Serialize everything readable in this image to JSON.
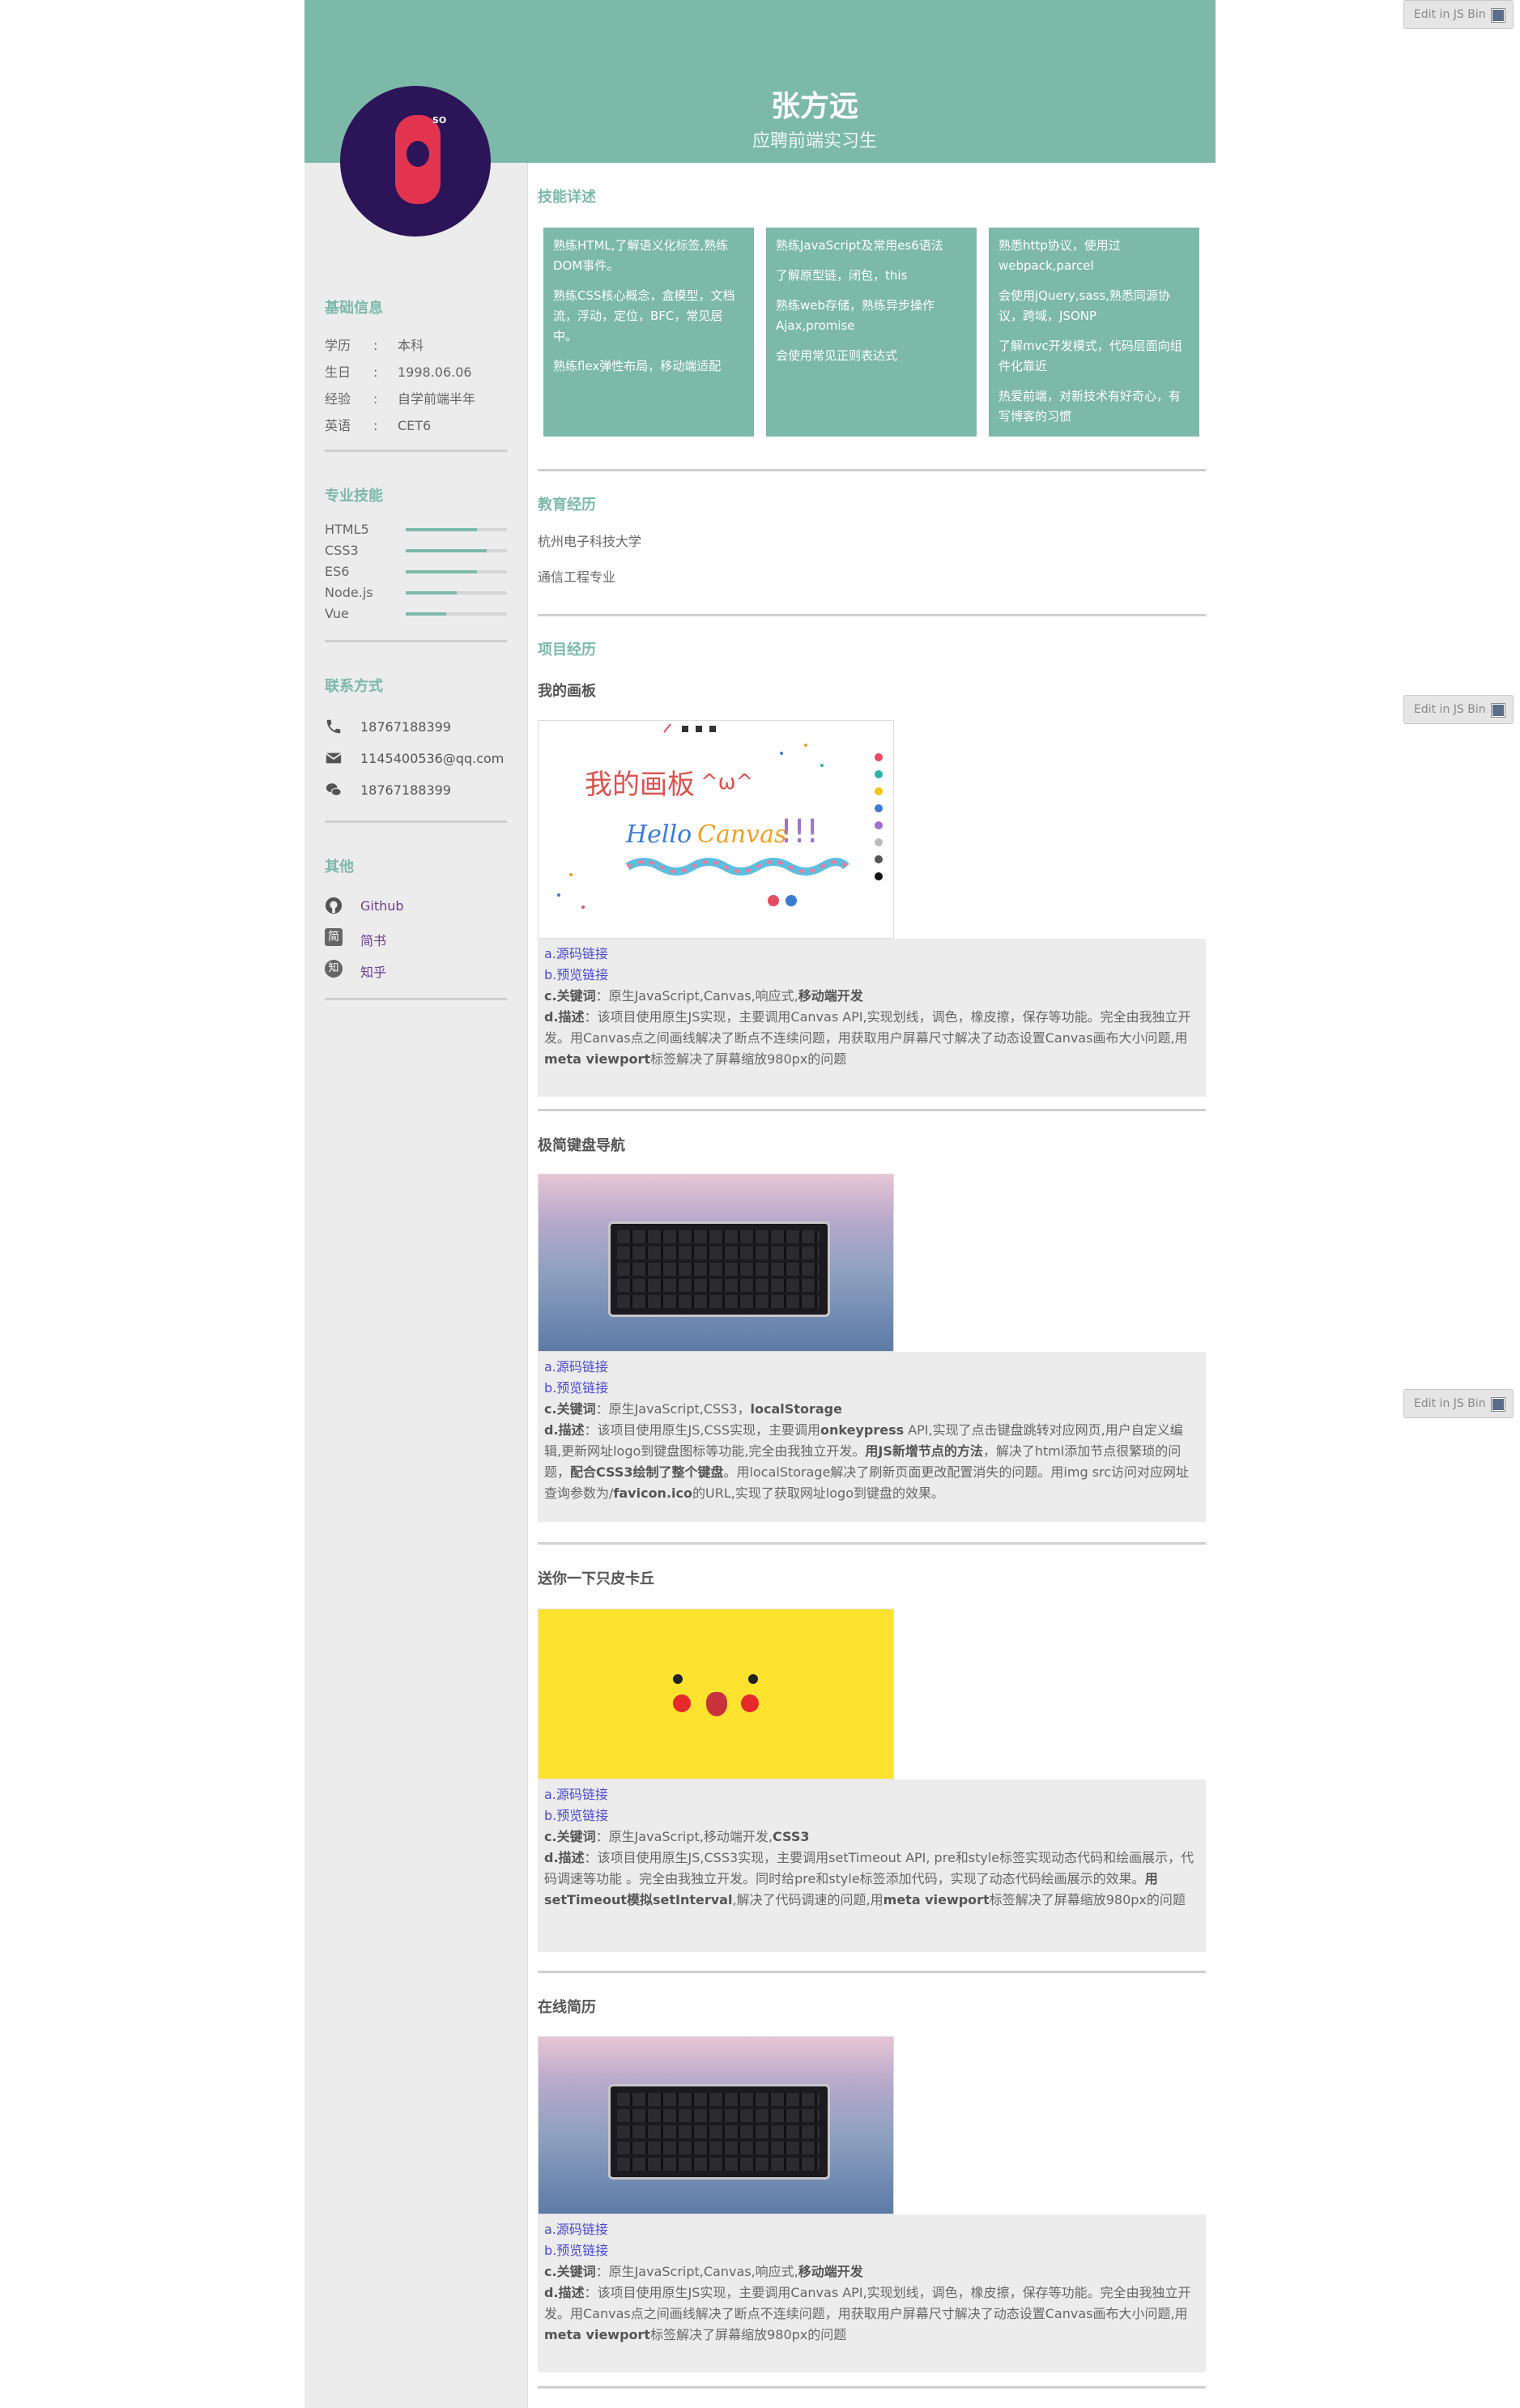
{
  "profile": {
    "name": "张方远",
    "role": "应聘前端实习生",
    "avatar_badge": "SO"
  },
  "sidebar": {
    "basic_title": "基础信息",
    "basic": [
      {
        "key": "学历",
        "sep": ":",
        "value": "本科"
      },
      {
        "key": "生日",
        "sep": ":",
        "value": "1998.06.06"
      },
      {
        "key": "经验",
        "sep": ":",
        "value": "自学前端半年"
      },
      {
        "key": "英语",
        "sep": ":",
        "value": "CET6"
      }
    ],
    "skills_title": "专业技能",
    "skills": [
      {
        "name": "HTML5",
        "level": 0.7
      },
      {
        "name": "CSS3",
        "level": 0.8
      },
      {
        "name": "ES6",
        "level": 0.7
      },
      {
        "name": "Node.js",
        "level": 0.5
      },
      {
        "name": "Vue",
        "level": 0.4
      }
    ],
    "contact_title": "联系方式",
    "contacts": [
      {
        "icon": "phone-icon",
        "text": "18767188399"
      },
      {
        "icon": "mail-icon",
        "text": "1145400536@qq.com"
      },
      {
        "icon": "wechat-icon",
        "text": "18767188399"
      }
    ],
    "other_title": "其他",
    "links": [
      {
        "icon": "github-icon",
        "glyph": "",
        "text": "Github"
      },
      {
        "icon": "jianshu-icon",
        "glyph": "简",
        "text": "简书"
      },
      {
        "icon": "zhihu-icon",
        "glyph": "知",
        "text": "知乎"
      }
    ]
  },
  "main": {
    "skills_title": "技能详述",
    "skill_boxes": [
      [
        "熟练HTML,了解语义化标签,熟练DOM事件。",
        "熟练CSS核心概念，盒模型，文档流，浮动，定位，BFC，常见居中。",
        "熟练flex弹性布局，移动端适配"
      ],
      [
        "熟练JavaScript及常用es6语法",
        "了解原型链，闭包，this",
        "熟练web存储，熟练异步操作Ajax,promise",
        "会使用常见正则表达式"
      ],
      [
        "熟悉http协议，使用过webpack,parcel",
        "会使用jQuery,sass,熟悉同源协议，跨域，JSONP",
        "了解mvc开发模式，代码层面向组件化靠近",
        "热爱前端，对新技术有好奇心，有写博客的习惯"
      ]
    ],
    "edu_title": "教育经历",
    "edu": [
      "杭州电子科技大学",
      "通信工程专业"
    ],
    "proj_title": "项目经历",
    "projects": [
      {
        "title": "我的画板",
        "source_link": "a.源码链接",
        "preview_link": "b.预览链接",
        "kw_label": "c.关键词",
        "kw_text": "：原生JavaScript,Canvas,响应式,",
        "kw_bold": "移动端开发",
        "desc_label": "d.描述",
        "desc_parts": [
          [
            "：该项目使用原生JS实现，主要调用Canvas API,实现划线，调色，橡皮擦，保存等功能。完全由我独立开发。用Canvas点之间画线解决了断点不连续问题，用获取用户屏幕尺寸解决了动态设置Canvas画布大小问题,用",
            false
          ],
          [
            "meta viewport",
            true
          ],
          [
            "标签解决了屏幕缩放980px的问题",
            false
          ]
        ]
      },
      {
        "title": "极简键盘导航",
        "source_link": "a.源码链接",
        "preview_link": "b.预览链接",
        "kw_label": "c.关键词",
        "kw_text": "：原生JavaScript,CSS3，",
        "kw_bold": "localStorage",
        "desc_label": "d.描述",
        "desc_parts": [
          [
            "：该项目使用原生JS,CSS实现，主要调用",
            false
          ],
          [
            "onkeypress",
            true
          ],
          [
            " API,实现了点击键盘跳转对应网页,用户自定义编辑,更新网址logo到键盘图标等功能,完全由我独立开发。",
            false
          ],
          [
            "用JS新增节点的方法",
            true
          ],
          [
            "，解决了html添加节点很繁琐的问题，",
            false
          ],
          [
            "配合CSS3绘制了整个键盘",
            true
          ],
          [
            "。用localStorage解决了刷新页面更改配置消失的问题。用img src访问对应网址查询参数为/",
            false
          ],
          [
            "favicon.ico",
            true
          ],
          [
            "的URL,实现了获取网址logo到键盘的效果。",
            false
          ]
        ]
      },
      {
        "title": "送你一下只皮卡丘",
        "source_link": "a.源码链接",
        "preview_link": "b.预览链接",
        "kw_label": "c.关键词",
        "kw_text": "：原生JavaScript,移动端开发,",
        "kw_bold": "CSS3",
        "desc_label": "d.描述",
        "desc_parts": [
          [
            "：该项目使用原生JS,CSS3实现，主要调用setTimeout API, pre和style标签实现动态代码和绘画展示，代码调速等功能 。完全由我独立开发。同时给pre和style标签添加代码，实现了动态代码绘画展示的效果。",
            false
          ],
          [
            "用setTimeout模拟setInterval",
            true
          ],
          [
            ",解决了代码调速的问题,用",
            false
          ],
          [
            "meta viewport",
            true
          ],
          [
            "标签解决了屏幕缩放980px的问题",
            false
          ]
        ]
      },
      {
        "title": "在线简历",
        "source_link": "a.源码链接",
        "preview_link": "b.预览链接",
        "kw_label": "c.关键词",
        "kw_text": "：原生JavaScript,Canvas,响应式,",
        "kw_bold": "移动端开发",
        "desc_label": "d.描述",
        "desc_parts": [
          [
            "：该项目使用原生JS实现，主要调用Canvas API,实现划线，调色，橡皮擦，保存等功能。完全由我独立开发。用Canvas点之间画线解决了断点不连续问题，用获取用户屏幕尺寸解决了动态设置Canvas画布大小问题,用",
            false
          ],
          [
            "meta viewport",
            true
          ],
          [
            "标签解决了屏幕缩放980px的问题",
            false
          ]
        ]
      }
    ],
    "canvas_texts": {
      "title": "我的画板",
      "face": "^ω^",
      "hello": "Hello",
      "canvas": "Canvas",
      "bang": "!!!"
    }
  },
  "jsbin": {
    "label": "Edit in JS Bin"
  },
  "colors": {
    "accent": "#7cb9a9",
    "link": "#4a4ad0",
    "sidebar_bg": "#ececec"
  }
}
